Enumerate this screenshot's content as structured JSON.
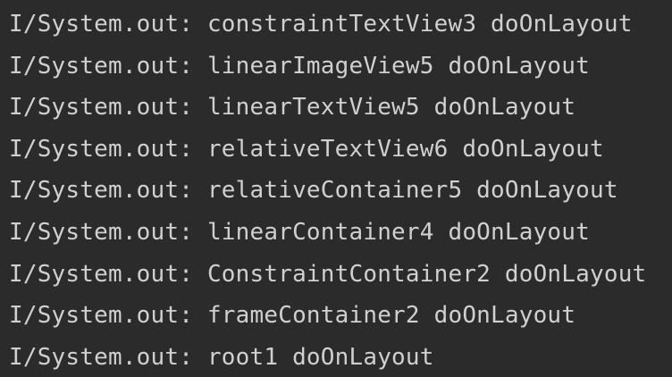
{
  "console": {
    "lines": [
      {
        "tag": "I/System.out:",
        "message": "constraintTextView3 doOnLayout"
      },
      {
        "tag": "I/System.out:",
        "message": "linearImageView5 doOnLayout"
      },
      {
        "tag": "I/System.out:",
        "message": "linearTextView5 doOnLayout"
      },
      {
        "tag": "I/System.out:",
        "message": "relativeTextView6 doOnLayout"
      },
      {
        "tag": "I/System.out:",
        "message": "relativeContainer5 doOnLayout"
      },
      {
        "tag": "I/System.out:",
        "message": "linearContainer4 doOnLayout"
      },
      {
        "tag": "I/System.out:",
        "message": "ConstraintContainer2 doOnLayout"
      },
      {
        "tag": "I/System.out:",
        "message": "frameContainer2 doOnLayout"
      },
      {
        "tag": "I/System.out:",
        "message": "root1 doOnLayout"
      }
    ]
  }
}
